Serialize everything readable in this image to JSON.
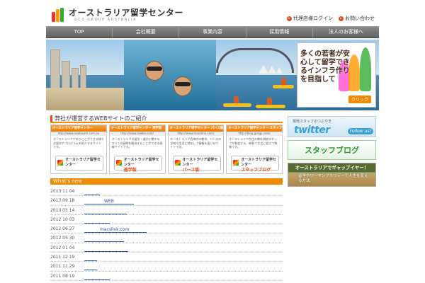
{
  "header": {
    "logo_title": "オーストラリア留学センター",
    "logo_sub": "GCS GROUP AUSTRALIA",
    "links": [
      {
        "label": "代理店様ログイン"
      },
      {
        "label": "お問い合わせ"
      }
    ]
  },
  "nav": [
    "TOP",
    "会社概要",
    "事業内容",
    "採用情報",
    "法人のお客様へ"
  ],
  "hero": {
    "promo_text": "多くの若者が安心して留学できるインフラ作りを目指して",
    "promo_button": "クリック"
  },
  "sites": {
    "title": "弊社が運営するWEBサイトのご紹介",
    "cards": [
      {
        "head": "オーストラリア留学センター",
        "url": "http://www.aswkwork.com.au",
        "desc": "オーストラリアで学ぶことができる様々な留学やプログラムを紹介するサイトです。",
        "banner": "オーストラリア留学センター",
        "tag": ""
      },
      {
        "head": "オーストラリア留学センター 進学版",
        "url": "http://www.aswka.com/",
        "desc": "オーストラリアの留学・進学に関するすべての疑問を解決することができる情報サイトです。",
        "banner": "オーストラリア留学センター",
        "tag": "進学版"
      },
      {
        "head": "オーストラリア留学センター パース版",
        "url": "http://www.macslink.com/",
        "desc": "オーストラリア西海岸の都市、パースの学校や生活に特化して情報を届けるサイトです。",
        "banner": "オーストラリア留学センター",
        "tag": "パース版"
      },
      {
        "head": "オーストラリア留学センター スタッフブログ",
        "url": "http://blog.gcsgp.com/",
        "desc": "オーストラリア在住の弊社現地スタッフが発信する、新鮮で生活に役立つ情報です。",
        "banner": "オーストラリア留学センター",
        "tag": "スタッフブログ"
      }
    ]
  },
  "news": {
    "title": "What's new",
    "items": [
      {
        "date": "2013 11 04",
        "text": ""
      },
      {
        "date": "2013 09 18",
        "text": "WEB"
      },
      {
        "date": "2013 05 14",
        "text": ""
      },
      {
        "date": "2012 10 03",
        "text": ""
      },
      {
        "date": "2012 06 27",
        "text": "macslink.com"
      },
      {
        "date": "2012 05 30",
        "text": ""
      },
      {
        "date": "2012 01 04",
        "text": ""
      },
      {
        "date": "2011 12 19",
        "text": ""
      },
      {
        "date": "2011 11 29",
        "text": ""
      },
      {
        "date": "2011 08 19",
        "text": ""
      }
    ]
  },
  "side": {
    "twitter_small": "現地スタッフのつぶやき",
    "twitter_logo": "twitter",
    "twitter_follow": "Follow us!",
    "blog_label": "スタッフブログ",
    "gap_title": "オーストラリアでギャップイヤー！",
    "gap_text": "留学やワーキングホリデーで人生を変える方法"
  },
  "colors": {
    "accent": "#f08a00",
    "nav": "#6e6e6e",
    "link": "#2255aa"
  }
}
